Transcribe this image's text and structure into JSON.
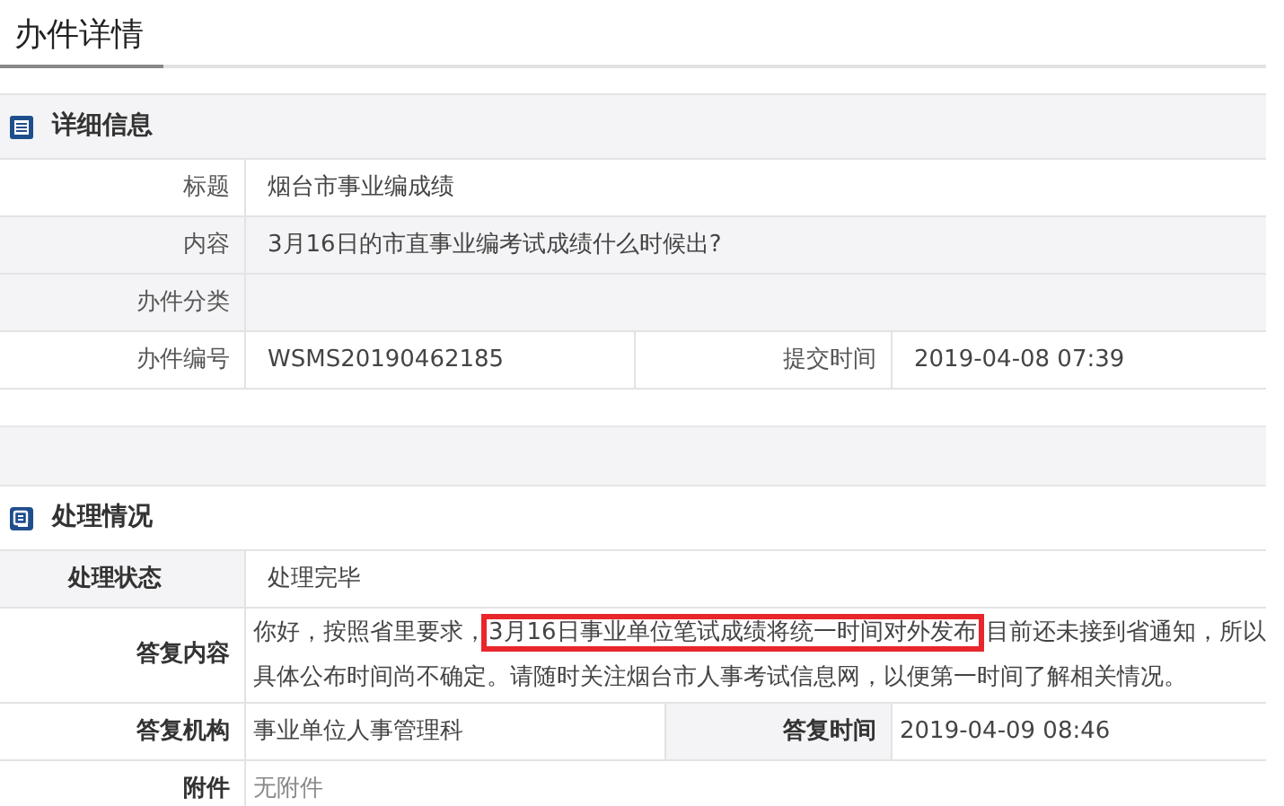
{
  "page_tab": {
    "label": "办件详情",
    "selected": true
  },
  "sections": [
    {
      "kind": "info",
      "title": "详细信息",
      "rows": [
        {
          "cells": [
            {
              "label": "标题",
              "value": "烟台市事业编成绩"
            }
          ]
        },
        {
          "cells": [
            {
              "label": "内容",
              "value": "3月16日的市直事业编考试成绩什么时候出?"
            }
          ]
        },
        {
          "cells": [
            {
              "label": "办件分类"
            }
          ]
        },
        {
          "cells": [
            {
              "label": "办件编号",
              "value": "WSMS20190462185"
            },
            {
              "label": "提交时间",
              "value": "2019-04-08 07:39"
            }
          ]
        }
      ]
    },
    {
      "kind": "processing",
      "title": "处理情况",
      "rows": [
        {
          "cells": [
            {
              "label": "处理状态",
              "value": "处理完毕"
            }
          ]
        },
        {
          "cells": [
            {
              "label": "答复内容",
              "parts": [
                {
                  "text": "你好，按照省里要求，",
                  "highlighted": false
                },
                {
                  "text": "3月16日事业单位笔试成绩将统一时间对外发布",
                  "highlighted": true
                },
                {
                  "text": " 目前还未接到省通知，所以具体公布时间尚不确定。请随时关注烟台市人事考试信息网，以便第一时间了解相关情况。",
                  "highlighted": false
                }
              ]
            }
          ]
        },
        {
          "cells": [
            {
              "label": "答复机构",
              "value": "事业单位人事管理科"
            },
            {
              "label": "答复时间",
              "value": "2019-04-09 08:46"
            }
          ]
        },
        {
          "cells": [
            {
              "label": "附件",
              "value": "无附件"
            }
          ]
        }
      ]
    }
  ]
}
